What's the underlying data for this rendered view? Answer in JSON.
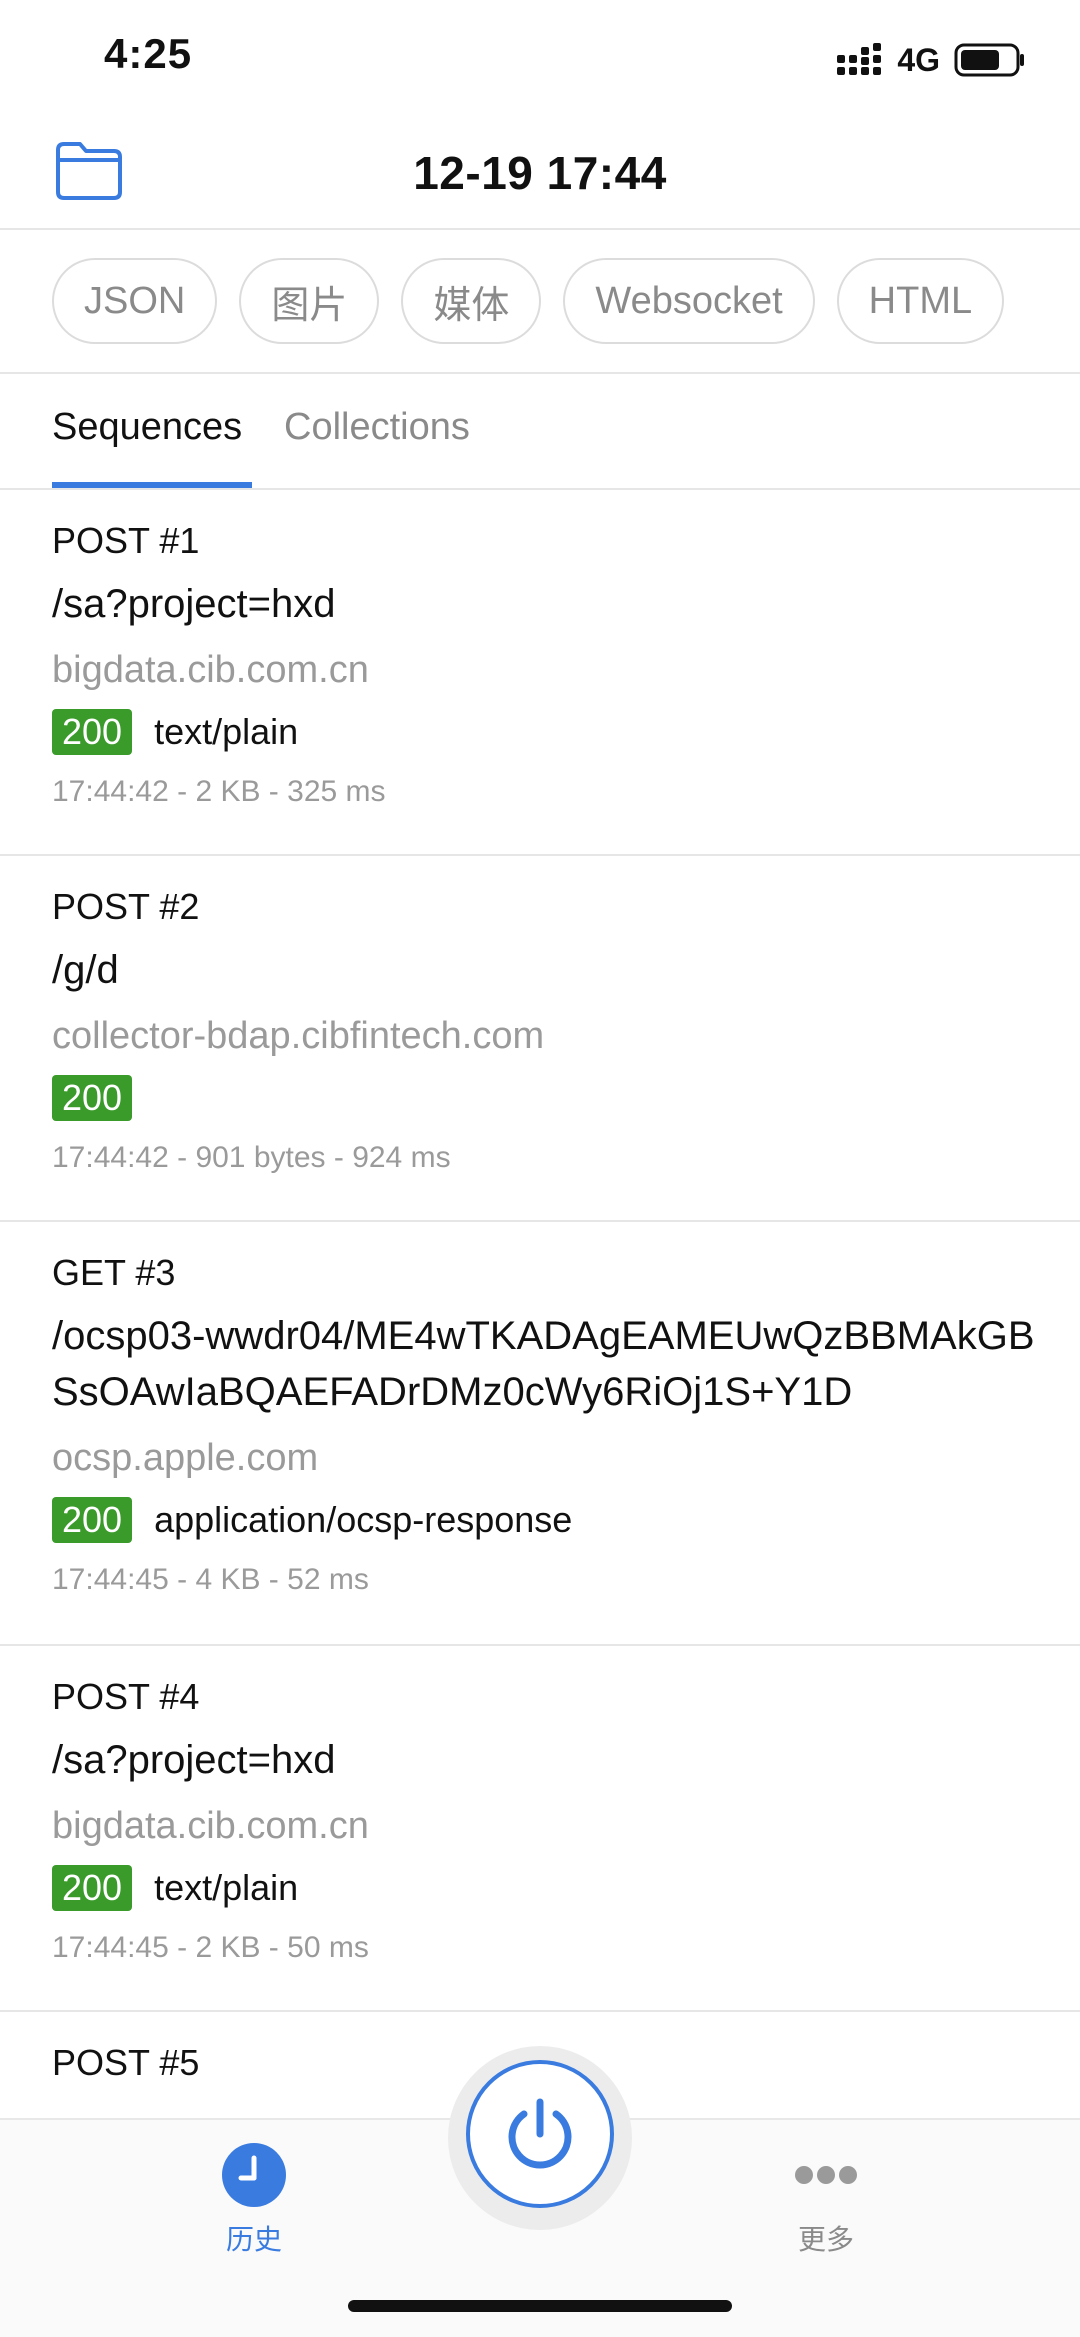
{
  "status_bar": {
    "time": "4:25",
    "network": "4G",
    "signal_icon": "signal-icon",
    "battery_icon": "battery-icon"
  },
  "header": {
    "title": "12-19 17:44",
    "folder_icon": "folder-icon"
  },
  "filters": [
    {
      "label": "JSON"
    },
    {
      "label": "图片"
    },
    {
      "label": "媒体"
    },
    {
      "label": "Websocket"
    },
    {
      "label": "HTML"
    }
  ],
  "tabs": {
    "sequences": "Sequences",
    "collections": "Collections",
    "active": "Sequences"
  },
  "requests": [
    {
      "method_line": "POST  #1",
      "path": "/sa?project=hxd",
      "host": "bigdata.cib.com.cn",
      "status": "200",
      "content_type": "text/plain",
      "meta": "17:44:42 - 2 KB - 325 ms"
    },
    {
      "method_line": "POST  #2",
      "path": "/g/d",
      "host": "collector-bdap.cibfintech.com",
      "status": "200",
      "content_type": "",
      "meta": "17:44:42 - 901 bytes - 924 ms"
    },
    {
      "method_line": "GET  #3",
      "path": "/ocsp03-wwdr04/ME4wTKADAgEAMEUwQzBBMAkGBSsOAwIaBQAEFADrDMz0cWy6RiOj1S+Y1D",
      "host": "ocsp.apple.com",
      "status": "200",
      "content_type": "application/ocsp-response",
      "meta": "17:44:45 - 4 KB - 52 ms"
    },
    {
      "method_line": "POST  #4",
      "path": "/sa?project=hxd",
      "host": "bigdata.cib.com.cn",
      "status": "200",
      "content_type": "text/plain",
      "meta": "17:44:45 - 2 KB - 50 ms"
    },
    {
      "method_line": "POST  #5",
      "path": "",
      "host": "",
      "status": "",
      "content_type": "",
      "meta": ""
    }
  ],
  "tabbar": {
    "history_label": "历史",
    "more_label": "更多",
    "history_icon": "clock-icon",
    "more_icon": "more-dots-icon",
    "power_icon": "power-icon"
  },
  "colors": {
    "accent": "#3a7be0",
    "status_ok": "#3a9a2a",
    "muted": "#9a9a9a"
  }
}
